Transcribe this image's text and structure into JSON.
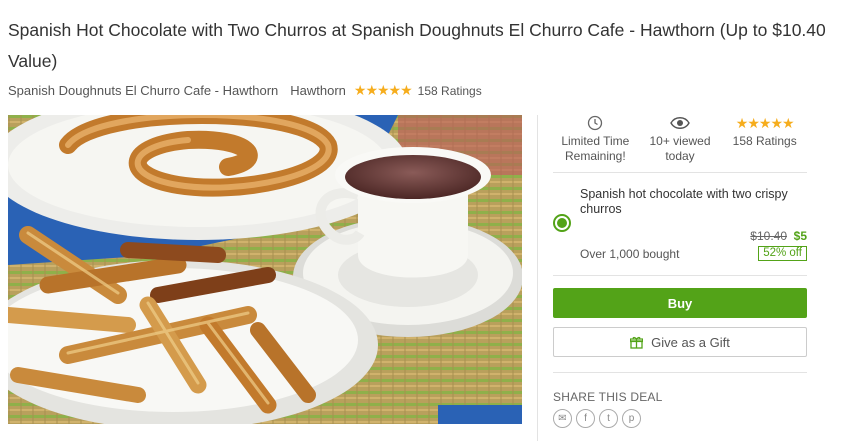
{
  "deal": {
    "title": "Spanish Hot Chocolate with Two Churros at Spanish Doughnuts El Churro Cafe - Hawthorn (Up to $10.40 Value)",
    "merchant": "Spanish Doughnuts El Churro Cafe - Hawthorn",
    "location": "Hawthorn",
    "stars": "★★★★★",
    "ratings": "158 Ratings",
    "image_alt": "Churros with hot chocolate"
  },
  "stats": [
    {
      "icon": "clock-icon",
      "line1": "Limited Time",
      "line2": "Remaining!"
    },
    {
      "icon": "eye-icon",
      "line1": "10+ viewed",
      "line2": "today"
    },
    {
      "icon": "stars-icon",
      "line1": "★★★★★",
      "line2": "158 Ratings"
    }
  ],
  "option": {
    "title": "Spanish hot chocolate with two crispy churros",
    "old_price": "$10.40",
    "new_price": "$5",
    "bought": "Over 1,000 bought",
    "discount": "52% off"
  },
  "buttons": {
    "buy": "Buy",
    "gift": "Give as a Gift"
  },
  "share": {
    "title": "SHARE THIS DEAL",
    "items": [
      {
        "icon": "email-icon",
        "glyph": "✉"
      },
      {
        "icon": "facebook-icon",
        "glyph": "f"
      },
      {
        "icon": "twitter-icon",
        "glyph": "t"
      },
      {
        "icon": "pinterest-icon",
        "glyph": "p"
      }
    ]
  },
  "colors": {
    "accent": "#53a318",
    "star": "#f6ad1d"
  }
}
